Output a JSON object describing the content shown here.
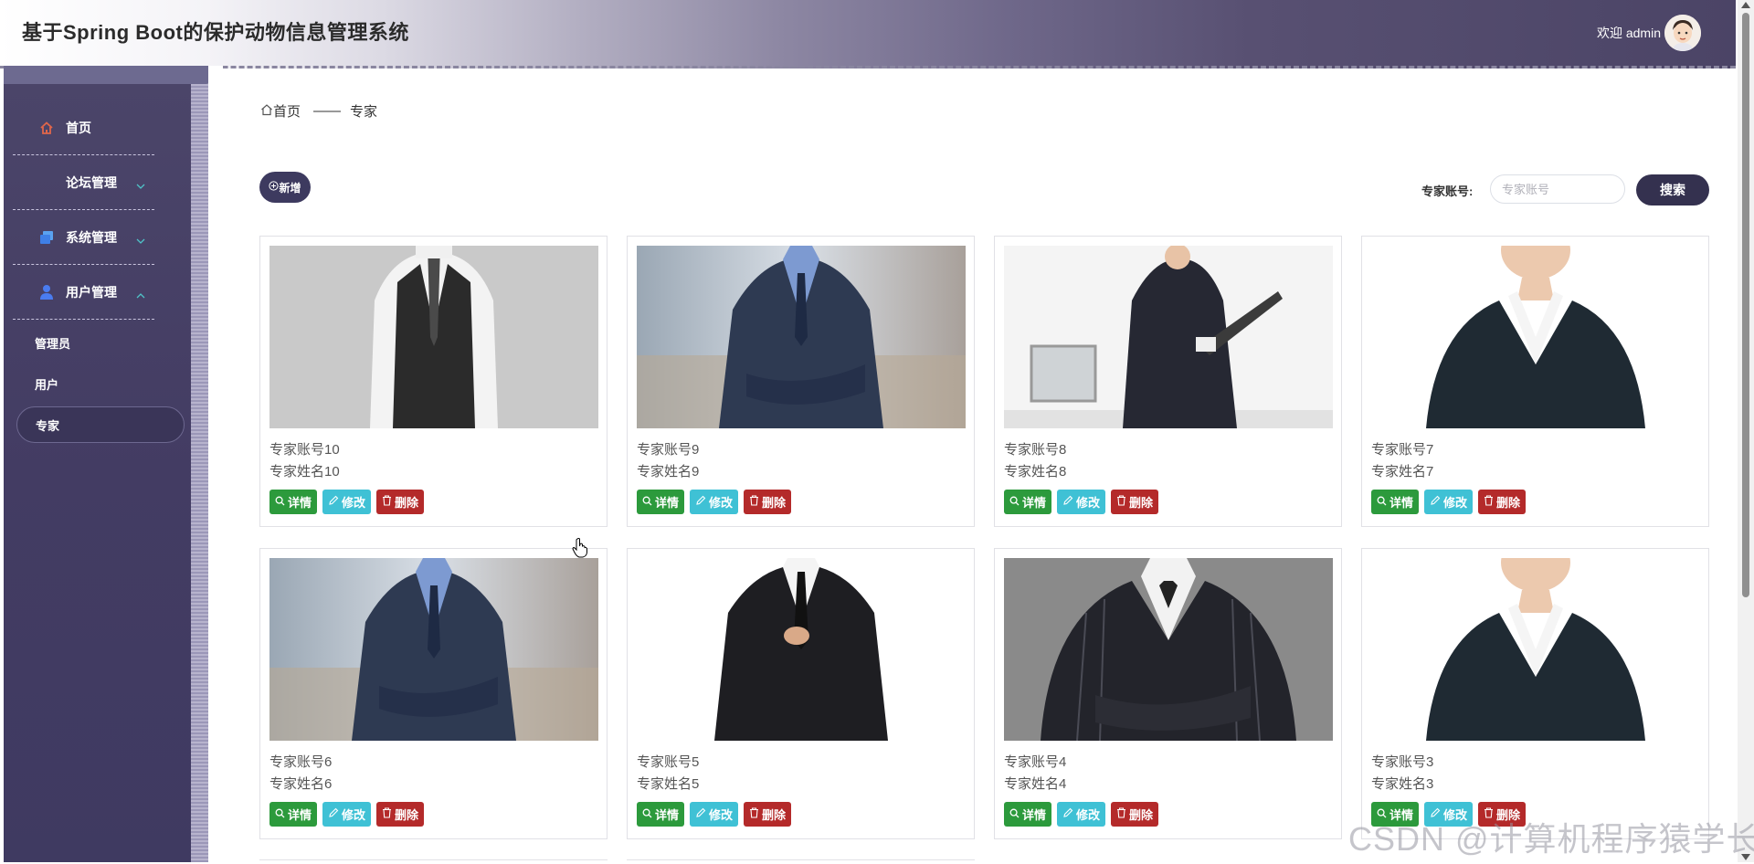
{
  "header": {
    "title": "基于Spring Boot的保护动物信息管理系统",
    "welcome": "欢迎 admin"
  },
  "sidebar": {
    "items": [
      {
        "label": "首页",
        "icon": "home-icon"
      },
      {
        "label": "论坛管理",
        "icon": ""
      },
      {
        "label": "系统管理",
        "icon": "system-icon"
      },
      {
        "label": "用户管理",
        "icon": "user-icon"
      }
    ],
    "sub_items": [
      {
        "label": "管理员"
      },
      {
        "label": "用户"
      },
      {
        "label": "专家",
        "active": true
      }
    ]
  },
  "breadcrumb": {
    "home": "首页",
    "separator": "——",
    "current": "专家"
  },
  "toolbar": {
    "add_label": "新增",
    "search_label": "专家账号:",
    "search_placeholder": "专家账号",
    "search_button": "搜索"
  },
  "cards": [
    {
      "account": "专家账号10",
      "name": "专家姓名10"
    },
    {
      "account": "专家账号9",
      "name": "专家姓名9"
    },
    {
      "account": "专家账号8",
      "name": "专家姓名8"
    },
    {
      "account": "专家账号7",
      "name": "专家姓名7"
    },
    {
      "account": "专家账号6",
      "name": "专家姓名6"
    },
    {
      "account": "专家账号5",
      "name": "专家姓名5"
    },
    {
      "account": "专家账号4",
      "name": "专家姓名4"
    },
    {
      "account": "专家账号3",
      "name": "专家姓名3"
    }
  ],
  "card_buttons": {
    "detail": "详情",
    "edit": "修改",
    "delete": "删除"
  },
  "watermark": "CSDN @计算机程序猿学长",
  "colors": {
    "sidebar": "#433c63",
    "accent": "#3d3a5f",
    "detail": "#2c9a3c",
    "edit": "#3fc1d5",
    "delete": "#b42a2a"
  }
}
